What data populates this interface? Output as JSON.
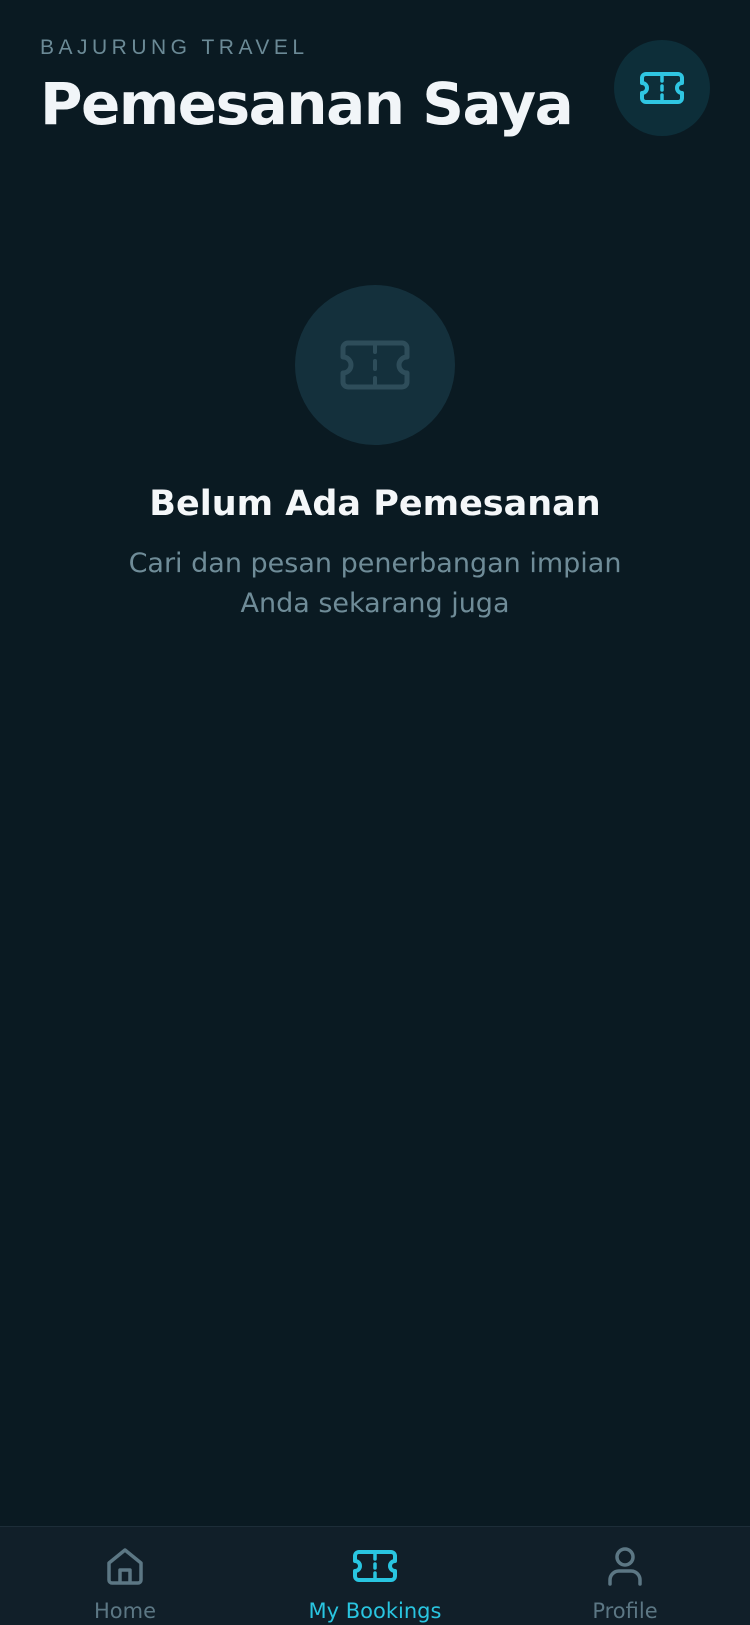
{
  "header": {
    "brand": "BAJURUNG TRAVEL",
    "title": "Pemesanan Saya",
    "action_icon": "ticket-icon"
  },
  "empty_state": {
    "icon": "ticket-icon",
    "title": "Belum Ada Pemesanan",
    "subtitle_line1": "Cari dan pesan penerbangan impian",
    "subtitle_line2": "Anda sekarang juga"
  },
  "bottom_nav": {
    "items": [
      {
        "label": "Home",
        "icon": "home-icon",
        "active": false
      },
      {
        "label": "My Bookings",
        "icon": "ticket-icon",
        "active": true
      },
      {
        "label": "Profile",
        "icon": "user-icon",
        "active": false
      }
    ]
  },
  "colors": {
    "background": "#0a1a22",
    "accent": "#29c5e0",
    "muted": "#6b8a96",
    "nav_background": "#111f29"
  }
}
